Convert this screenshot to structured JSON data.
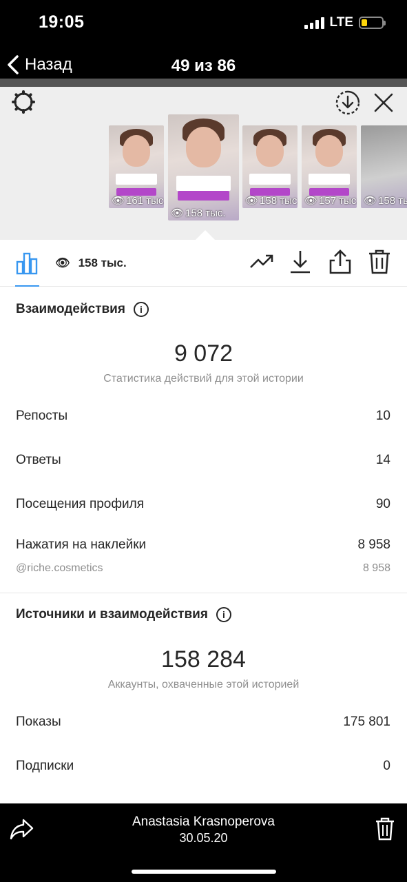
{
  "status": {
    "time": "19:05",
    "network": "LTE"
  },
  "nav": {
    "back_label": "Назад",
    "title": "49 из 86"
  },
  "viewer": {
    "thumbnails": [
      {
        "views": "161 тыс.",
        "active": false
      },
      {
        "views": "158 тыс.",
        "active": true
      },
      {
        "views": "158 тыс.",
        "active": false
      },
      {
        "views": "157 тыс.",
        "active": false
      },
      {
        "views": "158 тыс.",
        "active": false
      }
    ],
    "active_sticker": "@riche.cosmetics"
  },
  "toolbar": {
    "views": "158 тыс."
  },
  "interactions": {
    "title": "Взаимодействия",
    "total": "9 072",
    "subtitle": "Статистика действий для этой истории",
    "rows": [
      {
        "label": "Репосты",
        "value": "10"
      },
      {
        "label": "Ответы",
        "value": "14"
      },
      {
        "label": "Посещения профиля",
        "value": "90"
      },
      {
        "label": "Нажатия на наклейки",
        "value": "8 958"
      }
    ],
    "sticker_row": {
      "label": "@riche.cosmetics",
      "value": "8 958"
    }
  },
  "discovery": {
    "title": "Источники и взаимодействия",
    "total": "158 284",
    "subtitle": "Аккаунты, охваченные этой историей",
    "rows": [
      {
        "label": "Показы",
        "value": "175 801"
      },
      {
        "label": "Подписки",
        "value": "0"
      }
    ]
  },
  "bottom": {
    "name": "Anastasia Krasnoperova",
    "date": "30.05.20"
  }
}
